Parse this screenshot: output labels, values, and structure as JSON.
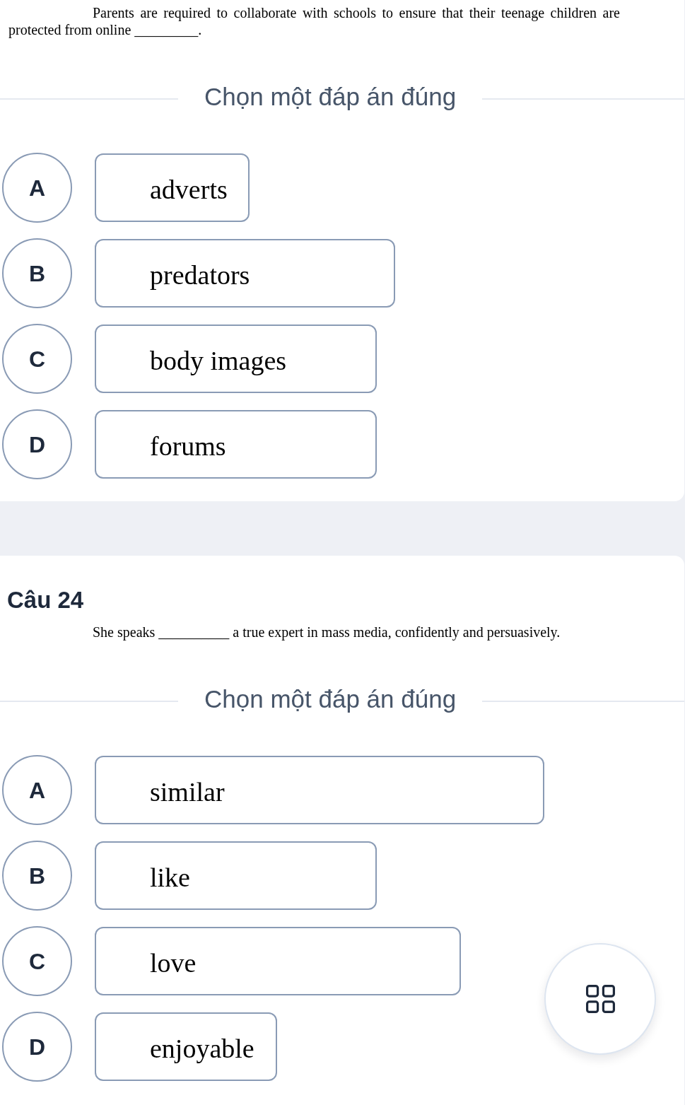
{
  "questions": [
    {
      "text": "Parents are required to collaborate with schools to ensure that their teenage children are protected from online _________.",
      "prompt": "Chọn một đáp án đúng",
      "options": [
        {
          "letter": "A",
          "text": "adverts",
          "selected": false
        },
        {
          "letter": "B",
          "text": "predators",
          "selected": false
        },
        {
          "letter": "C",
          "text": "body images",
          "selected": false
        },
        {
          "letter": "D",
          "text": "forums",
          "selected": false
        }
      ]
    },
    {
      "title": "Câu 24",
      "text": "She speaks __________ a true expert in mass media, confidently and persuasively.",
      "prompt": "Chọn một đáp án đúng",
      "options": [
        {
          "letter": "A",
          "text": "similar",
          "selected": false
        },
        {
          "letter": "B",
          "text": "like",
          "selected": false
        },
        {
          "letter": "C",
          "text": "love",
          "selected": false
        },
        {
          "letter": "D",
          "text": "enjoyable",
          "selected": false
        }
      ]
    }
  ]
}
